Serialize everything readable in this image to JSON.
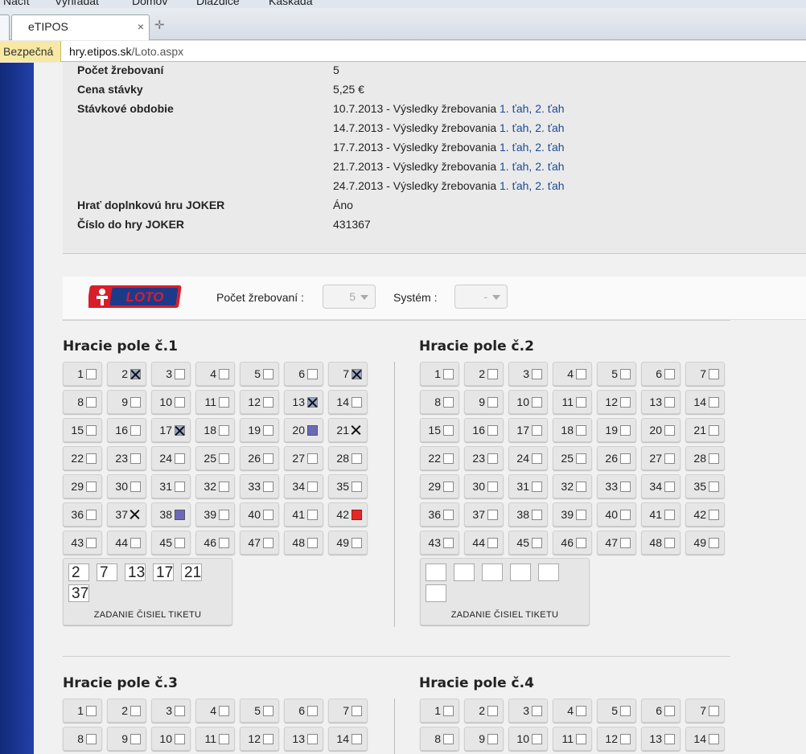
{
  "browser": {
    "menu": [
      "Načít",
      "Vyhľadať",
      "Domov",
      "Dlaždice",
      "Kaskáda"
    ],
    "tab_title": "eTIPOS",
    "tab_close": "×",
    "new_tab": "✛",
    "security_label": "Bezpečná",
    "url_host": "hry.etipos.sk",
    "url_path": "/Loto.aspx"
  },
  "ticket_info": {
    "draw_count_label": "Počet žrebovaní",
    "draw_count_value": "5",
    "price_label": "Cena stávky",
    "price_value": "5,25 €",
    "period_label": "Stávkové obdobie",
    "periods": [
      {
        "date": "10.7.2013 - Výsledky žrebovania",
        "d1": "1. ťah",
        "sep": ",",
        "d2": "2. ťah"
      },
      {
        "date": "14.7.2013 - Výsledky žrebovania",
        "d1": "1. ťah",
        "sep": ",",
        "d2": "2. ťah"
      },
      {
        "date": "17.7.2013 - Výsledky žrebovania",
        "d1": "1. ťah",
        "sep": ",",
        "d2": "2. ťah"
      },
      {
        "date": "21.7.2013 - Výsledky žrebovania",
        "d1": "1. ťah",
        "sep": ",",
        "d2": "2. ťah"
      },
      {
        "date": "24.7.2013 - Výsledky žrebovania",
        "d1": "1. ťah",
        "sep": ",",
        "d2": "2. ťah"
      }
    ],
    "joker_label": "Hrať doplnkovú hru JOKER",
    "joker_value": "Áno",
    "joker_number_label": "Číslo do hry JOKER",
    "joker_number_value": "431367"
  },
  "game_bar": {
    "logo_text": "LOTO",
    "draws_label": "Počet žrebovaní :",
    "draws_value": "5",
    "system_label": "Systém :",
    "system_value": "-"
  },
  "fields": [
    {
      "title": "Hracie pole č.1",
      "states": {
        "2": "x",
        "7": "x",
        "13": "x",
        "17": "x",
        "20": "blue",
        "21": "xn",
        "37": "xn",
        "38": "blue",
        "42": "red"
      },
      "entry": [
        "2",
        "7",
        "13",
        "17",
        "21",
        "37"
      ],
      "entry_caption": "ZADANIE ČISIEL TIKETU"
    },
    {
      "title": "Hracie pole č.2",
      "states": {},
      "entry": [
        "",
        "",
        "",
        "",
        "",
        ""
      ],
      "entry_caption": "ZADANIE ČISIEL TIKETU"
    },
    {
      "title": "Hracie pole č.3",
      "states": {}
    },
    {
      "title": "Hracie pole č.4",
      "states": {}
    }
  ],
  "colors": {
    "accent_link": "#1a4a9a",
    "left_bar": "#1a35a0",
    "marked_blue": "#6a6ab8",
    "marked_red": "#e02a2a"
  }
}
